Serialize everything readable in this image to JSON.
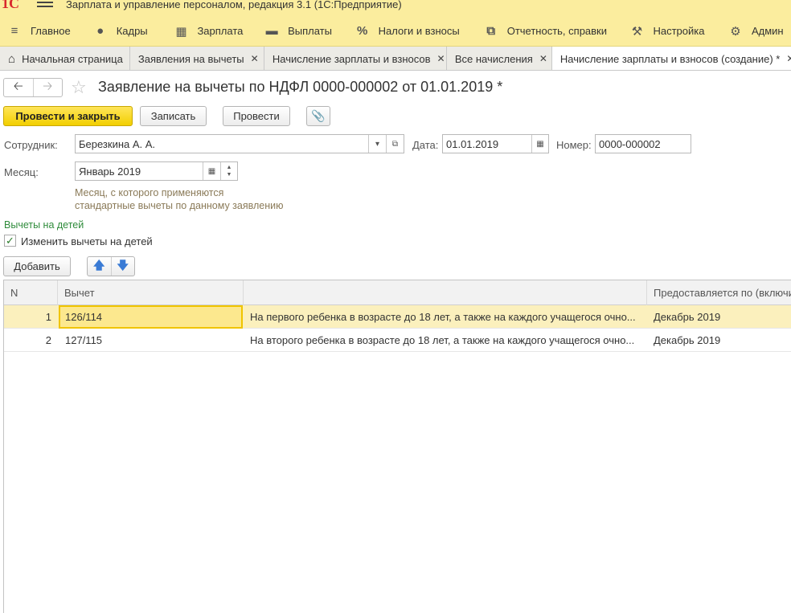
{
  "window": {
    "logo": "1С",
    "title": "Зарплата и управление персоналом, редакция 3.1  (1С:Предприятие)"
  },
  "menu": [
    {
      "label": "Главное",
      "icon": "≡",
      "icon_name": "main-menu-icon"
    },
    {
      "label": "Кадры",
      "icon": "👥",
      "icon_name": "people-icon"
    },
    {
      "label": "Зарплата",
      "icon": "▦",
      "icon_name": "calculator-icon"
    },
    {
      "label": "Выплаты",
      "icon": "▬",
      "icon_name": "wallet-icon"
    },
    {
      "label": "Налоги и взносы",
      "icon": "%",
      "icon_name": "percent-icon"
    },
    {
      "label": "Отчетность, справки",
      "icon": "⧉",
      "icon_name": "reports-icon"
    },
    {
      "label": "Настройка",
      "icon": "🔧",
      "icon_name": "wrench-icon"
    },
    {
      "label": "Админ",
      "icon": "⚙",
      "icon_name": "gear-icon"
    }
  ],
  "tabs": [
    {
      "label": "Начальная страница",
      "home_icon": "⌂"
    },
    {
      "label": "Заявления на вычеты"
    },
    {
      "label": "Начисление зарплаты и взносов"
    },
    {
      "label": "Все начисления"
    },
    {
      "label": "Начисление зарплаты и взносов (создание) *"
    }
  ],
  "form": {
    "title": "Заявление на вычеты по НДФЛ 0000-000002 от 01.01.2019 *",
    "buttons": {
      "post_close": "Провести и закрыть",
      "save": "Записать",
      "post": "Провести"
    },
    "employee_label": "Сотрудник:",
    "employee_value": "Березкина А. А.",
    "date_label": "Дата:",
    "date_value": "01.01.2019",
    "number_label": "Номер:",
    "number_value": "0000-000002",
    "month_label": "Месяц:",
    "month_value": "Январь 2019",
    "month_hint_line1": "Месяц, с которого применяются",
    "month_hint_line2": "стандартные вычеты по данному заявлению",
    "section_title": "Вычеты на детей",
    "checkbox_label": "Изменить вычеты на детей",
    "checkbox_checked": true,
    "add_button": "Добавить"
  },
  "table": {
    "columns": [
      "N",
      "Вычет",
      "",
      "Предоставляется по (включи"
    ],
    "rows": [
      {
        "n": "1",
        "code": "126/114",
        "description": "На первого ребенка в возрасте до 18 лет, а также на каждого учащегося очно...",
        "until": "Декабрь 2019"
      },
      {
        "n": "2",
        "code": "127/115",
        "description": "На второго ребенка в возрасте до 18 лет, а также на каждого учащегося очно...",
        "until": "Декабрь 2019"
      }
    ]
  },
  "colors": {
    "menu_bg": "#fbed9e",
    "primary_button": "#f5d40a",
    "selected_row": "#fbf0bd",
    "section_green": "#2e8b3a"
  }
}
